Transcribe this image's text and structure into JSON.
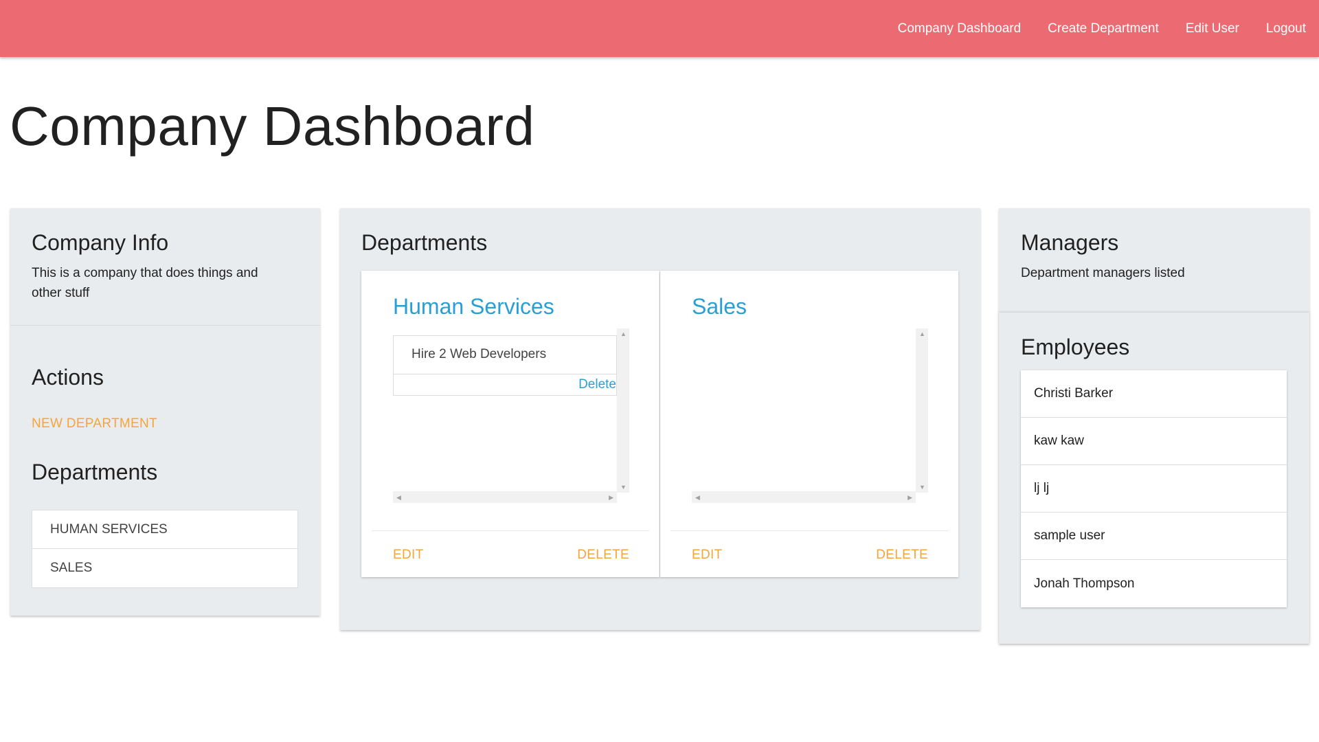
{
  "nav": {
    "links": [
      "Company Dashboard",
      "Create Department",
      "Edit User",
      "Logout"
    ]
  },
  "page_title": "Company Dashboard",
  "company_info": {
    "title": "Company Info",
    "description": "This is a company that does things and other stuff"
  },
  "actions": {
    "title": "Actions",
    "new_department": "NEW DEPARTMENT"
  },
  "sidebar_departments": {
    "title": "Departments",
    "items": [
      "HUMAN SERVICES",
      "SALES"
    ]
  },
  "departments": {
    "title": "Departments",
    "cards": [
      {
        "name": "Human Services",
        "tasks": [
          {
            "text": "Hire 2 Web Developers",
            "delete_label": "Delete"
          }
        ],
        "edit_label": "EDIT",
        "delete_label": "DELETE"
      },
      {
        "name": "Sales",
        "tasks": [],
        "edit_label": "EDIT",
        "delete_label": "DELETE"
      }
    ]
  },
  "managers": {
    "title": "Managers",
    "subtitle": "Department managers listed"
  },
  "employees": {
    "title": "Employees",
    "items": [
      "Christi Barker",
      "kaw kaw",
      "lj lj",
      "sample user",
      "Jonah Thompson"
    ]
  },
  "colors": {
    "header": "#ec6b72",
    "panel": "#e9ecef",
    "link_blue": "#2a9fd6",
    "action_orange": "#f5a43a"
  }
}
